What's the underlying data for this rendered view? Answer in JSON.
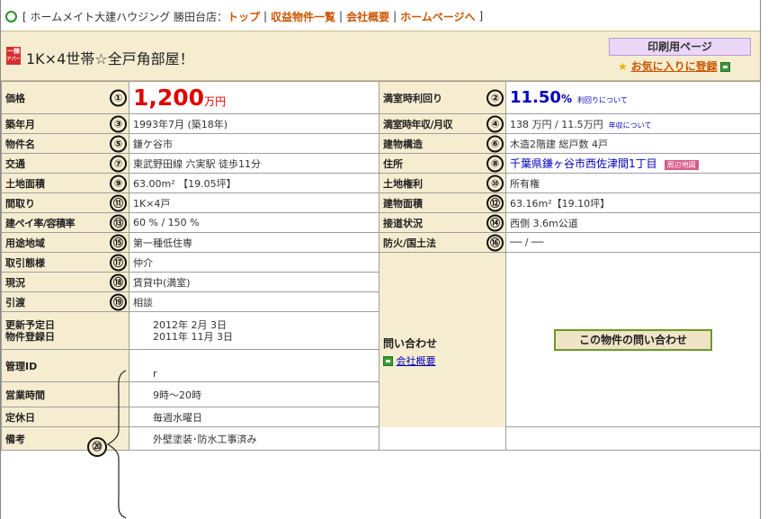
{
  "topnav": {
    "prefix": "[ ホームメイト大建ハウジング 勝田台店：",
    "links": [
      "トップ",
      "収益物件一覧",
      "会社概要",
      "ホームページへ"
    ],
    "suffix": "]"
  },
  "title": {
    "badge_line1": "一棟",
    "badge_line2": "アパート",
    "text": "1K×4世帯☆全戸角部屋！",
    "print_button": "印刷用ページ",
    "favorite_link": "お気に入りに登録"
  },
  "rows": [
    {
      "l_label": "価格",
      "l_num": "①",
      "l_value": "",
      "price": "1,200",
      "price_unit": "万円",
      "r_label": "満室時利回り",
      "r_num": "②",
      "yield": "11.50",
      "yield_unit": "%",
      "yield_link": "利回りについて"
    },
    {
      "l_label": "築年月",
      "l_num": "③",
      "l_value": "1993年7月 (築18年)",
      "r_label": "満室時年収/月収",
      "r_num": "④",
      "r_value": "138 万円 / 11.5万円",
      "r_link": "年収について"
    },
    {
      "l_label": "物件名",
      "l_num": "⑤",
      "l_value": "鎌ケ谷市",
      "r_label": "建物構造",
      "r_num": "⑥",
      "r_value": "木造2階建 総戸数 4戸"
    },
    {
      "l_label": "交通",
      "l_num": "⑦",
      "l_value": "東武野田線 六実駅 徒歩11分",
      "r_label": "住所",
      "r_num": "⑧",
      "r_value": "千葉県鎌ヶ谷市西佐津間1丁目",
      "map_badge": "周辺地図"
    },
    {
      "l_label": "土地面積",
      "l_num": "⑨",
      "l_value": "63.00m² 【19.05坪】",
      "r_label": "土地権利",
      "r_num": "⑩",
      "r_value": "所有権"
    },
    {
      "l_label": "間取り",
      "l_num": "⑪",
      "l_value": "1K×4戸",
      "r_label": "建物面積",
      "r_num": "⑫",
      "r_value": "63.16m²【19.10坪】"
    },
    {
      "l_label": "建ペイ率/容積率",
      "l_num": "⑬",
      "l_value": "60 % / 150 %",
      "r_label": "接道状況",
      "r_num": "⑭",
      "r_value": "西側 3.6m公道"
    },
    {
      "l_label": "用途地域",
      "l_num": "⑮",
      "l_value": "第一種低住専",
      "r_label": "防火/国土法",
      "r_num": "⑯",
      "r_value": "── / ──"
    },
    {
      "l_label": "取引態様",
      "l_num": "⑰",
      "l_value": "仲介"
    },
    {
      "l_label": "現況",
      "l_num": "⑱",
      "l_value": "賃貸中(満室)"
    },
    {
      "l_label": "引渡",
      "l_num": "⑲",
      "l_value": "相談"
    }
  ],
  "inquiry": {
    "title": "問い合わせ",
    "company_link": "会社概要",
    "button": "この物件の問い合わせ"
  },
  "extra": {
    "update_label1": "更新予定日",
    "update_label2": "物件登録日",
    "update_value1": "2012年 2月 3日",
    "update_value2": "2011年 11月 3日",
    "manager_label": "管理ID",
    "manager_value": "r",
    "hours_label": "営業時間",
    "hours_value": "9時〜20時",
    "holiday_label": "定休日",
    "holiday_value": "毎週水曜日",
    "remarks_label": "備考",
    "remarks_value": "外壁塗装･防水工事済み",
    "brace_num": "⑳"
  }
}
